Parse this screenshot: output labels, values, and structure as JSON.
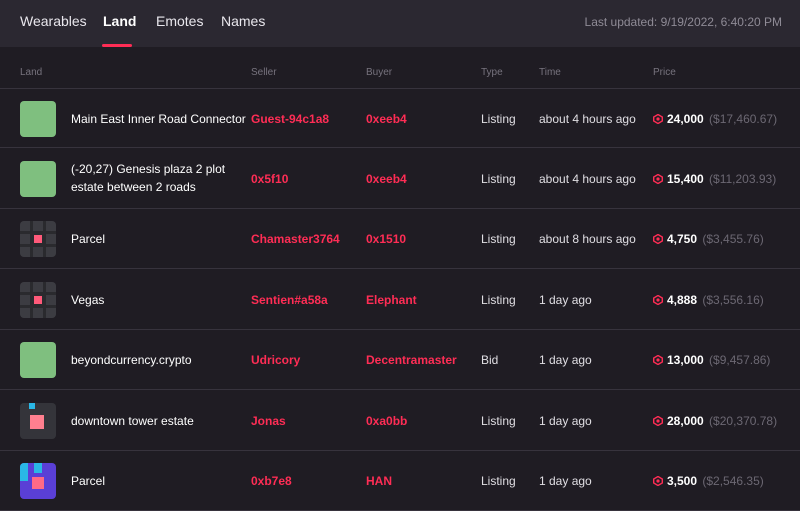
{
  "tabs": [
    {
      "label": "Wearables",
      "active": false
    },
    {
      "label": "Land",
      "active": true
    },
    {
      "label": "Emotes",
      "active": false
    },
    {
      "label": "Names",
      "active": false
    }
  ],
  "last_updated": "Last updated: 9/19/2022, 6:40:20 PM",
  "columns": {
    "land": "Land",
    "seller": "Seller",
    "buyer": "Buyer",
    "type": "Type",
    "time": "Time",
    "price": "Price"
  },
  "rows": [
    {
      "thumb": "estate-green",
      "name": "Main East Inner Road Connector",
      "seller": "Guest-94c1a8",
      "buyer": "0xeeb4",
      "type": "Listing",
      "time": "about 4 hours ago",
      "price": "24,000",
      "usd": "($17,460.67)"
    },
    {
      "thumb": "estate-green",
      "name": "(-20,27) Genesis plaza 2 plot estate between 2 roads",
      "seller": "0x5f10",
      "buyer": "0xeeb4",
      "type": "Listing",
      "time": "about 4 hours ago",
      "price": "15,400",
      "usd": "($11,203.93)"
    },
    {
      "thumb": "parcel-map",
      "name": "Parcel",
      "seller": "Chamaster3764",
      "buyer": "0x1510",
      "type": "Listing",
      "time": "about 8 hours ago",
      "price": "4,750",
      "usd": "($3,455.76)"
    },
    {
      "thumb": "parcel-map",
      "name": "Vegas",
      "seller": "Sentien#a58a",
      "buyer": "Elephant",
      "type": "Listing",
      "time": "1 day ago",
      "price": "4,888",
      "usd": "($3,556.16)"
    },
    {
      "thumb": "estate-green",
      "name": "beyondcurrency.crypto",
      "seller": "Udricory",
      "buyer": "Decentramaster",
      "type": "Bid",
      "time": "1 day ago",
      "price": "13,000",
      "usd": "($9,457.86)"
    },
    {
      "thumb": "tower-map",
      "name": "downtown tower estate",
      "seller": "Jonas",
      "buyer": "0xa0bb",
      "type": "Listing",
      "time": "1 day ago",
      "price": "28,000",
      "usd": "($20,370.78)"
    },
    {
      "thumb": "purple-parcel",
      "name": "Parcel",
      "seller": "0xb7e8",
      "buyer": "HAN",
      "type": "Listing",
      "time": "1 day ago",
      "price": "3,500",
      "usd": "($2,546.35)"
    }
  ],
  "colors": {
    "accent": "#ff2d55",
    "background": "#1f1c23",
    "topbar": "#2b2831",
    "estate_green": "#7fbf7f"
  }
}
